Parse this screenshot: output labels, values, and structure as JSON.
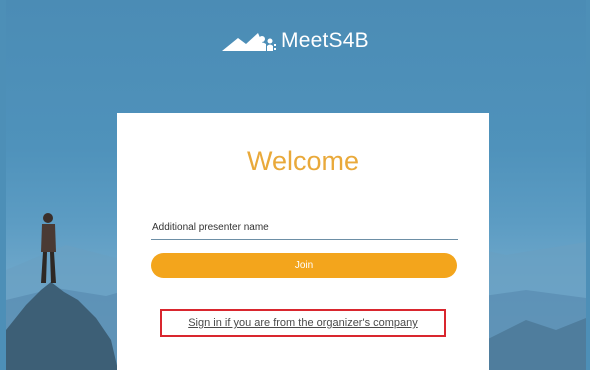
{
  "header": {
    "brand_name": "MeetS4B",
    "logo_icon": "mountain-people-logo-icon"
  },
  "card": {
    "title": "Welcome",
    "name_input": {
      "value": "",
      "placeholder": "Additional presenter name"
    },
    "join_label": "Join",
    "signin_link": "Sign in if you are from the organizer's company"
  },
  "colors": {
    "title": "#e9a93a",
    "button": "#f3a51c",
    "highlight_box": "#d9262e",
    "background": "#4d8fb7"
  }
}
